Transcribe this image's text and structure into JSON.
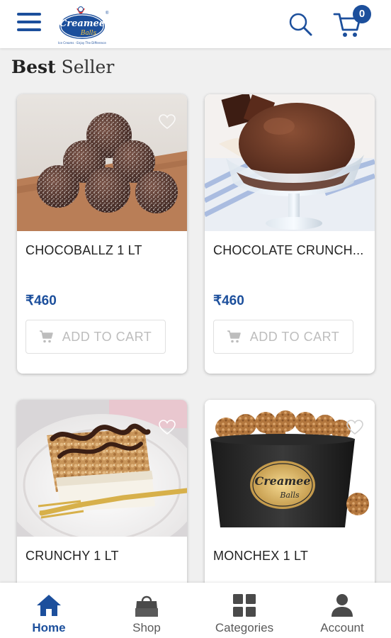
{
  "header": {
    "menu_icon": "hamburger-menu-icon",
    "logo_text": "Creamee",
    "logo_subtext": "Balls",
    "logo_tagline": "Ice Creams · Enjoy The Difference",
    "search_icon": "search-icon",
    "cart_icon": "shopping-cart-icon",
    "cart_count": "0",
    "brand_color": "#1c4f9c"
  },
  "section": {
    "title_bold": "Best",
    "title_light": "Seller"
  },
  "products": [
    {
      "name": "CHOCOBALLZ 1 LT",
      "price": "₹460",
      "add_to_cart": "ADD TO CART"
    },
    {
      "name": "CHOCOLATE CRUNCH...",
      "price": "₹460",
      "add_to_cart": "ADD TO CART"
    },
    {
      "name": "CRUNCHY 1 LT",
      "price": "",
      "add_to_cart": ""
    },
    {
      "name": "MONCHEX 1 LT",
      "price": "",
      "add_to_cart": ""
    }
  ],
  "bottom_nav": [
    {
      "label": "Home",
      "icon": "home-icon",
      "active": true
    },
    {
      "label": "Shop",
      "icon": "shopping-bag-icon",
      "active": false
    },
    {
      "label": "Categories",
      "icon": "grid-icon",
      "active": false
    },
    {
      "label": "Account",
      "icon": "person-icon",
      "active": false
    }
  ]
}
